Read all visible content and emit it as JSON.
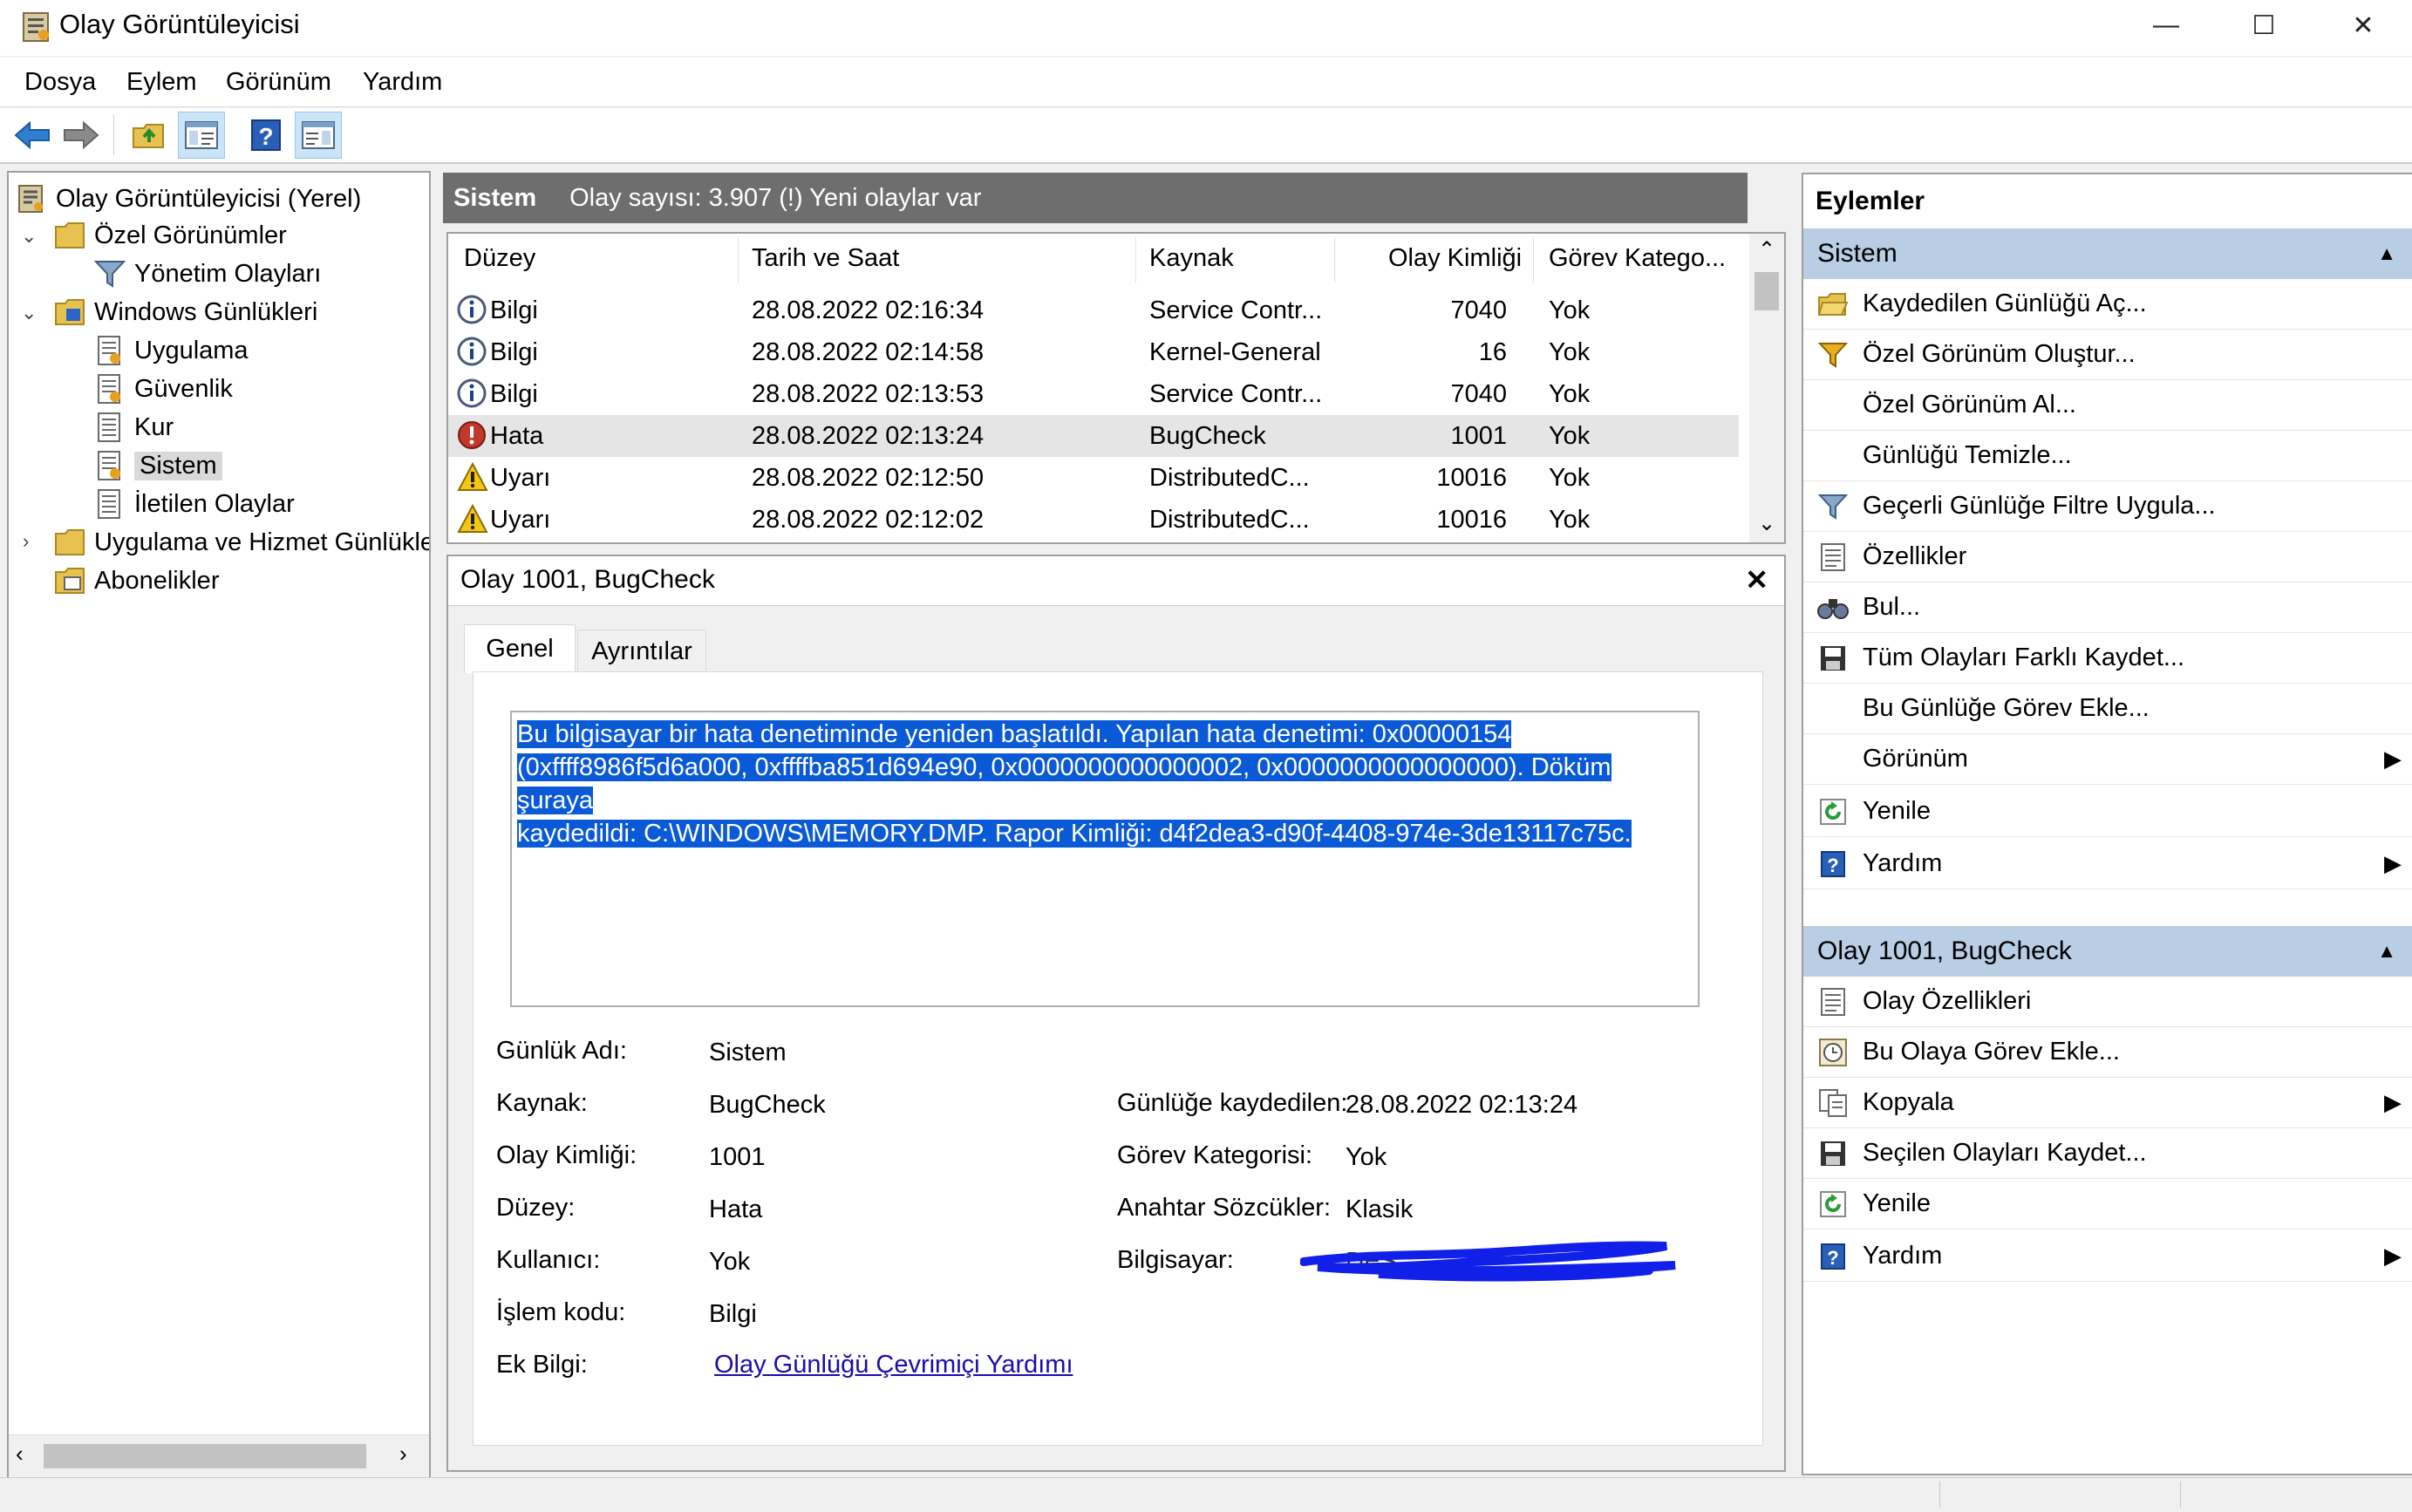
{
  "window": {
    "title": "Olay Görüntüleyicisi",
    "minimize": "—",
    "maximize": "☐",
    "close": "✕"
  },
  "menu": [
    "Dosya",
    "Eylem",
    "Görünüm",
    "Yardım"
  ],
  "tree": {
    "root": "Olay Görüntüleyicisi (Yerel)",
    "custom_views": "Özel Görünümler",
    "admin_events": "Yönetim Olayları",
    "windows_logs": "Windows Günlükleri",
    "application": "Uygulama",
    "security": "Güvenlik",
    "setup": "Kur",
    "system": "Sistem",
    "forwarded": "İletilen Olaylar",
    "app_services": "Uygulama ve Hizmet Günlükle",
    "subscriptions": "Abonelikler"
  },
  "center": {
    "log_name": "Sistem",
    "summary": "Olay sayısı: 3.907 (!) Yeni olaylar var",
    "columns": [
      "Düzey",
      "Tarih ve Saat",
      "Kaynak",
      "Olay Kimliği",
      "Görev Katego..."
    ],
    "rows": [
      {
        "level": "Bilgi",
        "icon": "info-icon",
        "date": "28.08.2022 02:16:34",
        "source": "Service Contr...",
        "id": "7040",
        "task": "Yok"
      },
      {
        "level": "Bilgi",
        "icon": "info-icon",
        "date": "28.08.2022 02:14:58",
        "source": "Kernel-General",
        "id": "16",
        "task": "Yok"
      },
      {
        "level": "Bilgi",
        "icon": "info-icon",
        "date": "28.08.2022 02:13:53",
        "source": "Service Contr...",
        "id": "7040",
        "task": "Yok"
      },
      {
        "level": "Hata",
        "icon": "error-icon",
        "date": "28.08.2022 02:13:24",
        "source": "BugCheck",
        "id": "1001",
        "task": "Yok"
      },
      {
        "level": "Uyarı",
        "icon": "warning-icon",
        "date": "28.08.2022 02:12:50",
        "source": "DistributedC...",
        "id": "10016",
        "task": "Yok"
      },
      {
        "level": "Uyarı",
        "icon": "warning-icon",
        "date": "28.08.2022 02:12:02",
        "source": "DistributedC...",
        "id": "10016",
        "task": "Yok"
      }
    ]
  },
  "detail": {
    "title": "Olay 1001, BugCheck",
    "close": "✕",
    "tabs": [
      "Genel",
      "Ayrıntılar"
    ],
    "message_lines": [
      "Bu bilgisayar bir hata denetiminde yeniden başlatıldı. Yapılan hata denetimi: 0x00000154",
      "(0xffff8986f5d6a000, 0xffffba851d694e90, 0x0000000000000002, 0x0000000000000000). Döküm şuraya",
      "kaydedildi: C:\\WINDOWS\\MEMORY.DMP. Rapor Kimliği: d4f2dea3-d90f-4408-974e-3de13117c75c."
    ],
    "labels": {
      "log_name": "Günlük Adı:",
      "source": "Kaynak:",
      "event_id": "Olay Kimliği:",
      "level": "Düzey:",
      "user": "Kullanıcı:",
      "opcode": "İşlem kodu:",
      "more_info": "Ek Bilgi:",
      "logged": "Günlüğe kaydedilen:",
      "task_category": "Görev Kategorisi:",
      "keywords": "Anahtar Sözcükler:",
      "computer": "Bilgisayar:"
    },
    "values": {
      "log_name": "Sistem",
      "source": "BugCheck",
      "event_id": "1001",
      "level": "Hata",
      "user": "Yok",
      "opcode": "Bilgi",
      "more_info": "Olay Günlüğü Çevrimiçi Yardımı",
      "logged": "28.08.2022 02:13:24",
      "task_category": "Yok",
      "keywords": "Klasik",
      "computer": "DES"
    }
  },
  "actions": {
    "header": "Eylemler",
    "section1": "Sistem",
    "items1": [
      "Kaydedilen Günlüğü Aç...",
      "Özel Görünüm Oluştur...",
      "Özel Görünüm Al...",
      "Günlüğü Temizle...",
      "Geçerli Günlüğe Filtre Uygula...",
      "Özellikler",
      "Bul...",
      "Tüm Olayları Farklı Kaydet...",
      "Bu Günlüğe Görev Ekle...",
      "Görünüm",
      "Yenile",
      "Yardım"
    ],
    "section2": "Olay 1001, BugCheck",
    "items2": [
      "Olay Özellikleri",
      "Bu Olaya Görev Ekle...",
      "Kopyala",
      "Seçilen Olayları Kaydet...",
      "Yenile",
      "Yardım"
    ]
  },
  "colors": {
    "section_header": "#b9cde5",
    "selection": "#0a5ad7",
    "log_header": "#6e6e6e",
    "link": "#1a0dab"
  }
}
